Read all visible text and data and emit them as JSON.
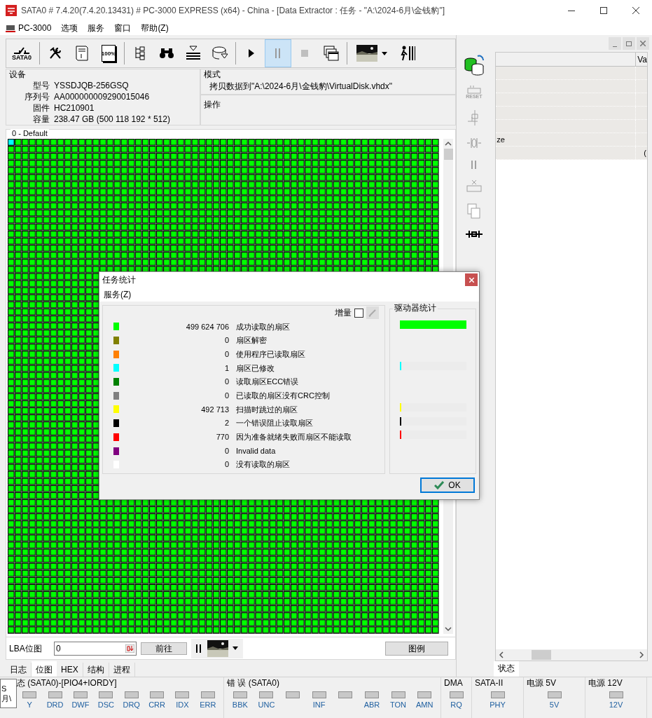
{
  "window": {
    "title": "SATA0 # 7.4.20(7.4.20.13431) # PC-3000 EXPRESS (x64) - China - [Data Extractor : 任务 - \"A:\\2024-6月\\金钱豹\"]"
  },
  "menu": [
    "PC-3000",
    "选项",
    "服务",
    "窗口",
    "帮助(Z)"
  ],
  "toolbar": [
    {
      "kind": "sata",
      "label": "SATA0",
      "pressed": false,
      "disabled": false
    },
    {
      "kind": "separator"
    },
    {
      "kind": "tools",
      "pressed": false,
      "disabled": false
    },
    {
      "kind": "hexdoc",
      "pressed": false,
      "disabled": false
    },
    {
      "kind": "percent",
      "label": "100%",
      "pressed": false,
      "disabled": false
    },
    {
      "kind": "separator"
    },
    {
      "kind": "tree",
      "pressed": false,
      "disabled": false
    },
    {
      "kind": "binoculars",
      "pressed": false,
      "disabled": false
    },
    {
      "kind": "stack",
      "pressed": false,
      "disabled": false
    },
    {
      "kind": "disk",
      "pressed": false,
      "disabled": false
    },
    {
      "kind": "separator"
    },
    {
      "kind": "play",
      "pressed": false,
      "disabled": false
    },
    {
      "kind": "pause",
      "pressed": true,
      "disabled": false
    },
    {
      "kind": "stop",
      "pressed": false,
      "disabled": true
    },
    {
      "kind": "windows",
      "pressed": false,
      "disabled": false
    },
    {
      "kind": "separator"
    },
    {
      "kind": "thumbnail",
      "pressed": false,
      "disabled": false
    },
    {
      "kind": "runner",
      "pressed": false,
      "disabled": false
    }
  ],
  "device": {
    "title": "设备",
    "fields": [
      {
        "label": "型号",
        "value": "YSSDJQB-256GSQ"
      },
      {
        "label": "序列号",
        "value": "AA000000009290015046"
      },
      {
        "label": "固件",
        "value": "HC210901"
      },
      {
        "label": "容量",
        "value": "238.47 GB (500 118 192 * 512)"
      }
    ]
  },
  "mode": {
    "title": "模式",
    "value": "拷贝数据到\"A:\\2024-6月\\金钱豹\\VirtualDisk.vhdx\"",
    "operation_title": "操作"
  },
  "map": {
    "title": "0 - Default"
  },
  "lba": {
    "label": "LBA位图",
    "value": "0",
    "go": "前往",
    "legend": "图例"
  },
  "tabs": [
    {
      "label": "日志",
      "selected": false
    },
    {
      "label": "位图",
      "selected": true
    },
    {
      "label": "HEX",
      "selected": false
    },
    {
      "label": "结构",
      "selected": false
    },
    {
      "label": "进程",
      "selected": false
    }
  ],
  "side_toolbar": {
    "reset_label": "RESET"
  },
  "right_panel": {
    "column": "Va",
    "rows": [
      {
        "text": ""
      },
      {
        "text": ""
      },
      {
        "text": ""
      },
      {
        "text": ""
      },
      {
        "text": ""
      },
      {
        "text": "ze"
      },
      {
        "text": "("
      }
    ],
    "tabs": [
      {
        "label": "状态",
        "selected": true
      }
    ]
  },
  "dialog": {
    "title": "任务统计",
    "menu": "服务(Z)",
    "increment": {
      "label": "增量",
      "checked": false
    },
    "drive_stats_title": "驱动器统计",
    "ok": "OK",
    "rows": [
      {
        "color": "#00ff00",
        "count": "499 624 706",
        "label": "成功读取的扇区",
        "level": 1
      },
      {
        "color": "#808000",
        "count": "0",
        "label": "扇区解密"
      },
      {
        "color": "#ff8000",
        "count": "0",
        "label": "使用程序已读取扇区"
      },
      {
        "color": "#00ffff",
        "count": "1",
        "label": "扇区已修改",
        "level": 0.02
      },
      {
        "color": "#008000",
        "count": "0",
        "label": "读取扇区ECC错误"
      },
      {
        "color": "#808080",
        "count": "0",
        "label": "已读取的扇区没有CRC控制"
      },
      {
        "color": "#ffff00",
        "count": "492 713",
        "label": "扫描时跳过的扇区",
        "level": 0.02
      },
      {
        "color": "#000000",
        "count": "2",
        "label": "一个错误阻止读取扇区",
        "level": 0.02
      },
      {
        "color": "#ff0000",
        "count": "770",
        "label": "因为准备就绪失败而扇区不能读取",
        "level": 0.02
      },
      {
        "color": "#800080",
        "count": "0",
        "label": "Invalid data"
      },
      {
        "color": "#ffffff",
        "count": "0",
        "label": "没有读取的扇区"
      }
    ]
  },
  "tooltip": {
    "lines": [
      "S",
      "月\\"
    ]
  },
  "status_groups": [
    {
      "title": "态 (SATA0)-[PIO4+IORDY]",
      "leds": [
        {
          "kind": "labeled",
          "label": "Y"
        },
        {
          "kind": "labeled",
          "label": "DRD"
        },
        {
          "kind": "labeled",
          "label": "DWF"
        },
        {
          "kind": "labeled",
          "label": "DSC"
        },
        {
          "kind": "labeled",
          "label": "DRQ"
        },
        {
          "kind": "labeled",
          "label": "CRR"
        },
        {
          "kind": "labeled",
          "label": "IDX"
        },
        {
          "kind": "labeled",
          "label": "ERR"
        }
      ]
    },
    {
      "title": "错 误 (SATA0)",
      "leds": [
        {
          "kind": "labeled",
          "label": "BBK"
        },
        {
          "kind": "labeled",
          "label": "UNC"
        },
        {
          "kind": "unlabeled"
        },
        {
          "kind": "labeled",
          "label": "INF"
        },
        {
          "kind": "unlabeled"
        },
        {
          "kind": "labeled",
          "label": "ABR"
        },
        {
          "kind": "labeled",
          "label": "TON"
        },
        {
          "kind": "labeled",
          "label": "AMN"
        }
      ]
    },
    {
      "title": "DMA",
      "leds": [
        {
          "kind": "labeled",
          "label": "RQ"
        }
      ]
    },
    {
      "title": "SATA-II",
      "leds": [
        {
          "kind": "labeled",
          "label": "PHY"
        }
      ]
    },
    {
      "title": "电源 5V",
      "leds": [
        {
          "kind": "labeled",
          "label": "5V"
        }
      ]
    },
    {
      "title": "电源 12V",
      "leds": [
        {
          "kind": "labeled",
          "label": "12V"
        }
      ]
    }
  ]
}
